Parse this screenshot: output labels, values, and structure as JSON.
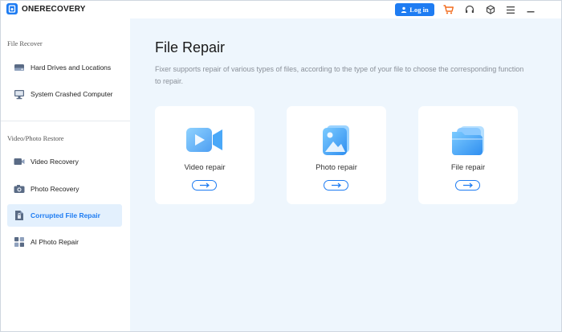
{
  "app": {
    "brand_name": "ONERECOVERY"
  },
  "titlebar": {
    "login_label": "Log in",
    "icons": [
      "user-icon",
      "cart-icon",
      "headset-icon",
      "cube-icon",
      "menu-icon",
      "minimize-icon"
    ]
  },
  "sidebar": {
    "section1_title": "File Recover",
    "section1_items": [
      {
        "label": "Hard Drives and Locations",
        "icon": "hard-drive-icon"
      },
      {
        "label": "System Crashed Computer",
        "icon": "computer-icon"
      }
    ],
    "section2_title": "Video/Photo Restore",
    "section2_items": [
      {
        "label": "Video Recovery",
        "icon": "video-icon"
      },
      {
        "label": "Photo Recovery",
        "icon": "camera-icon"
      },
      {
        "label": "Corrupted File Repair",
        "icon": "file-repair-icon",
        "active": true
      },
      {
        "label": "AI Photo Repair",
        "icon": "ai-photo-icon"
      }
    ]
  },
  "main": {
    "title": "File Repair",
    "description": "Fixer supports repair of various types of files, according to the type of your file to choose the corresponding function to repair.",
    "cards": [
      {
        "label": "Video repair",
        "icon": "video-repair-icon"
      },
      {
        "label": "Photo repair",
        "icon": "photo-repair-icon"
      },
      {
        "label": "File repair",
        "icon": "file-repair-icon"
      }
    ]
  },
  "colors": {
    "accent": "#1e7cf2",
    "active_bg": "#e3f0fd",
    "main_bg": "#eef6fd"
  }
}
